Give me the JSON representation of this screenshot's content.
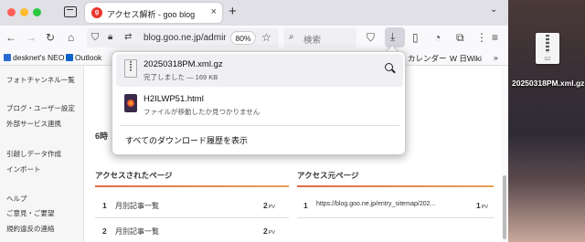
{
  "browser": {
    "tab": {
      "title": "アクセス解析 - goo blog",
      "favicon_letter": "g"
    },
    "url": "blog.goo.ne.jp/admin",
    "zoom": "80%",
    "search_placeholder": "検索"
  },
  "bookmarks": [
    {
      "label": "desknet's NEO"
    },
    {
      "label": "Outlook"
    },
    {
      "label": "カレンダー"
    },
    {
      "label": "W 日Wiki"
    }
  ],
  "sidebar": {
    "items": [
      "フォトチャンネル一覧",
      "ブログ・ユーザー設定",
      "外部サービス連携",
      "引越しデータ作成",
      "インポート",
      "ヘルプ",
      "ご意見・ご要望",
      "規約違反の連絡"
    ]
  },
  "content": {
    "section_time": "6時",
    "accessed_pages": {
      "heading": "アクセスされたページ",
      "rows": [
        {
          "rank": "1",
          "title": "月別記事一覧",
          "pv": "2",
          "unit": "PV"
        },
        {
          "rank": "2",
          "title": "月別記事一覧",
          "pv": "2",
          "unit": "PV"
        }
      ]
    },
    "referrers": {
      "heading": "アクセス元ページ",
      "rows": [
        {
          "rank": "1",
          "url": "https://blog.goo.ne.jp/entry_sitemap/202...",
          "pv": "1",
          "unit": "PV"
        }
      ]
    }
  },
  "downloads": {
    "items": [
      {
        "name": "20250318PM.xml.gz",
        "status": "完了しました — 169 KB"
      },
      {
        "name": "H2ILWP51.html",
        "status": "ファイルが移動したか見つかりません"
      }
    ],
    "show_all": "すべてのダウンロード履歴を表示"
  },
  "desktop": {
    "file_label": "20250318PM.xml.gz",
    "file_ext": "GZ"
  },
  "colors": {
    "tab_favicon": "#e8352a",
    "section_underline": "#e36a4a"
  }
}
